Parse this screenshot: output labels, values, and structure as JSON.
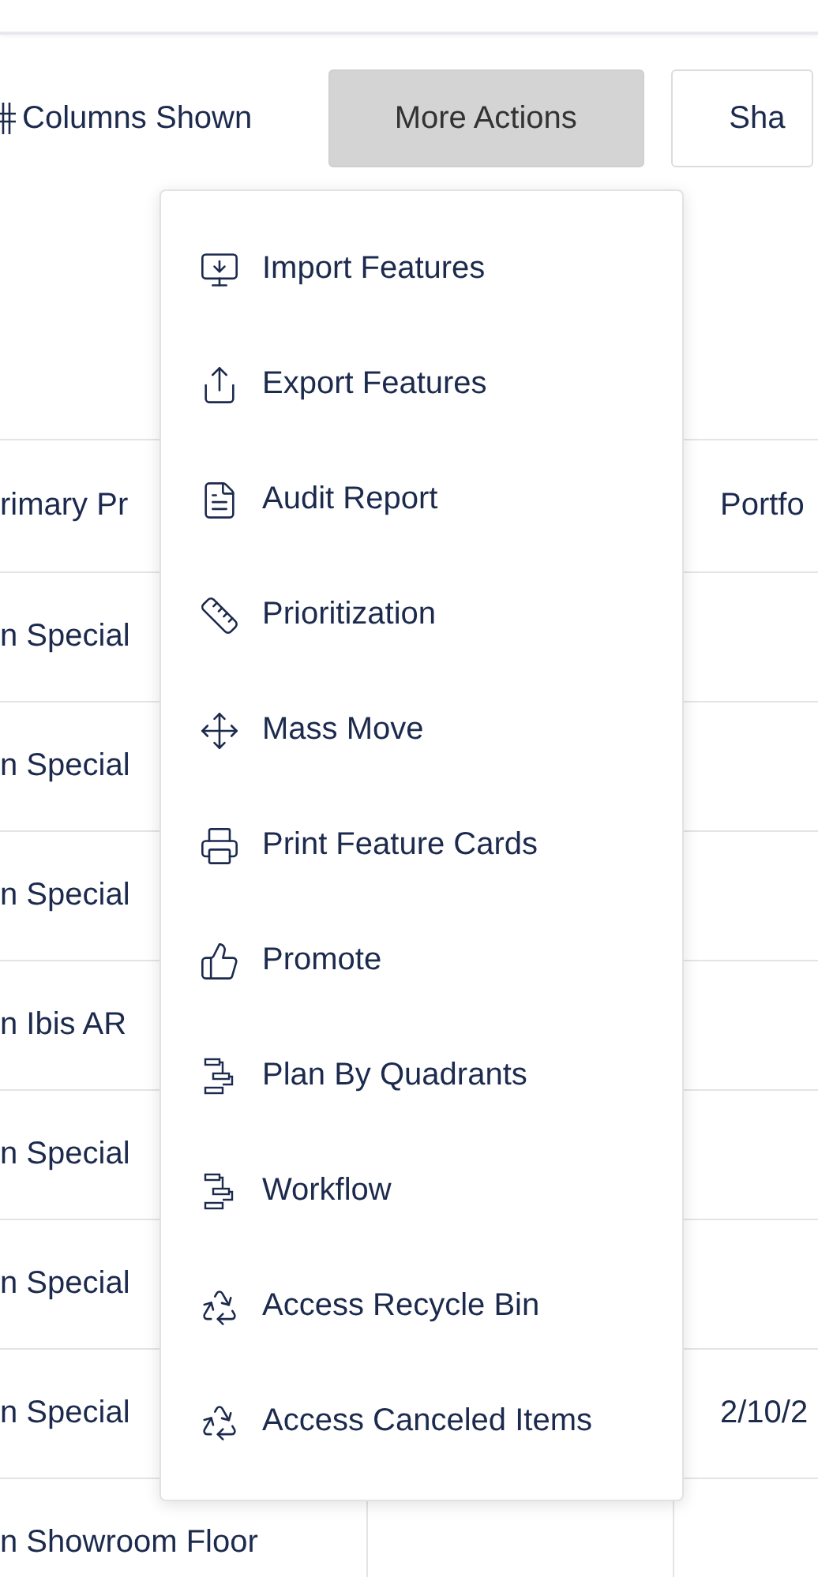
{
  "toolbar": {
    "columns_label": "Columns Shown",
    "buttons": [
      {
        "label": "More Actions",
        "selected": true
      },
      {
        "label": "Sha",
        "selected": false
      }
    ]
  },
  "table": {
    "header": {
      "column_1": "rimary Pr",
      "column_3": "Portfo"
    },
    "rows": [
      {
        "column_1": "n Special"
      },
      {
        "column_1": "n Special"
      },
      {
        "column_1": "n Special"
      },
      {
        "column_1": "n Ibis AR"
      },
      {
        "column_1": "n Special"
      },
      {
        "column_1": "n Special"
      },
      {
        "column_1": "n Special",
        "column_3": "2/10/2"
      },
      {
        "column_1": "n Showroom Floor"
      }
    ]
  },
  "menu": [
    {
      "kind": "import",
      "label": "Import Features"
    },
    {
      "kind": "export",
      "label": "Export Features"
    },
    {
      "kind": "audit",
      "label": "Audit Report"
    },
    {
      "kind": "ruler",
      "label": "Prioritization"
    },
    {
      "kind": "move",
      "label": "Mass Move"
    },
    {
      "kind": "print",
      "label": "Print Feature Cards"
    },
    {
      "kind": "promote",
      "label": "Promote"
    },
    {
      "kind": "steps",
      "label": "Plan By Quadrants"
    },
    {
      "kind": "steps",
      "label": "Workflow"
    },
    {
      "kind": "recycle",
      "label": "Access Recycle Bin"
    },
    {
      "kind": "recycle",
      "label": "Access Canceled Items"
    }
  ]
}
